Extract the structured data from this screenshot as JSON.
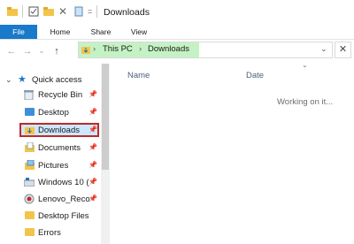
{
  "window": {
    "title": "Downloads"
  },
  "ribbon": {
    "tabs": [
      "File",
      "Home",
      "Share",
      "View"
    ]
  },
  "address": {
    "crumbs": [
      "This PC",
      "Downloads"
    ]
  },
  "nav": {
    "quick_access": "Quick access",
    "items": [
      {
        "label": "Recycle Bin",
        "icon": "recycle-bin-icon",
        "pinned": true
      },
      {
        "label": "Desktop",
        "icon": "desktop-folder-icon",
        "pinned": true
      },
      {
        "label": "Downloads",
        "icon": "downloads-folder-icon",
        "pinned": true,
        "selected": true
      },
      {
        "label": "Documents",
        "icon": "documents-folder-icon",
        "pinned": true
      },
      {
        "label": "Pictures",
        "icon": "pictures-folder-icon",
        "pinned": true
      },
      {
        "label": "Windows 10 (",
        "icon": "drive-icon",
        "pinned": true
      },
      {
        "label": "Lenovo_Reco",
        "icon": "recovery-drive-icon",
        "pinned": true
      },
      {
        "label": "Desktop Files",
        "icon": "folder-icon",
        "pinned": false
      },
      {
        "label": "Errors",
        "icon": "folder-icon",
        "pinned": false
      }
    ]
  },
  "main": {
    "columns": [
      "Name",
      "Date"
    ],
    "status": "Working on it..."
  },
  "colors": {
    "accent": "#1979ca",
    "highlight_border": "#c0282a",
    "address_green": "#c5f2c5"
  }
}
